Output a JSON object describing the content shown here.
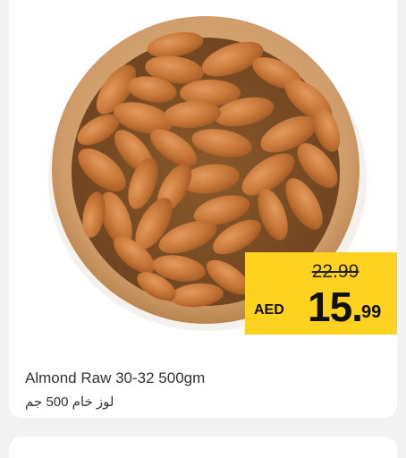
{
  "product": {
    "name_en": "Almond Raw 30-32 500gm",
    "name_ar": "لوز خام 500 جم",
    "image_subject": "bowl-of-almonds"
  },
  "price": {
    "old": "22.99",
    "currency": "AED",
    "current_int": "15.",
    "current_dec": "99",
    "badge_color": "#ffd21f"
  }
}
